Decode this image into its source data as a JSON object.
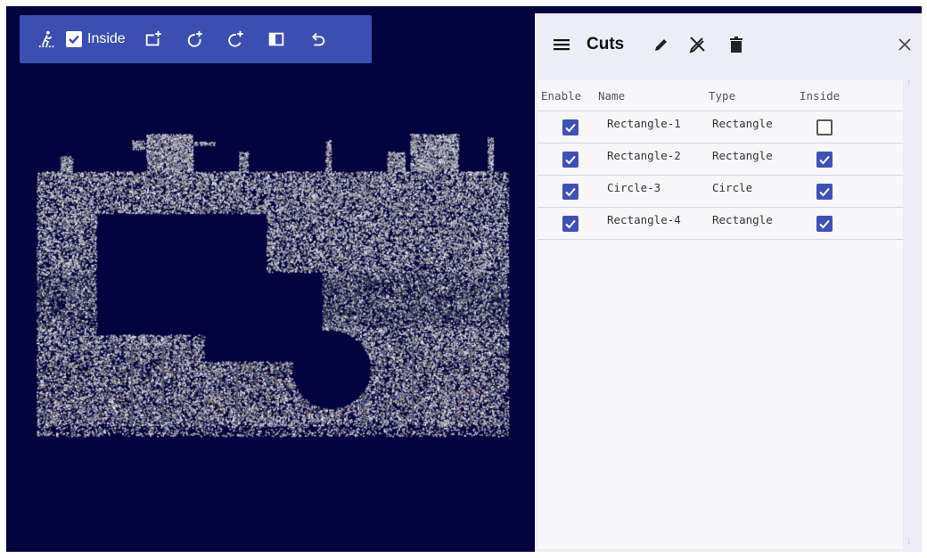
{
  "colors": {
    "viewport_bg": "#02033f",
    "toolbar_bg": "#3b4fb1",
    "accent": "#3f51b5",
    "panel_bg": "#ecedf7"
  },
  "toolbar": {
    "items": [
      {
        "icon": "person-walk-icon"
      },
      {
        "icon": "checkbox-checked-icon",
        "label": "Inside",
        "checked": true
      },
      {
        "icon": "add-rectangle-icon"
      },
      {
        "icon": "add-circle-icon"
      },
      {
        "icon": "add-circle-alt-icon"
      },
      {
        "icon": "rectangle-toggle-icon"
      },
      {
        "icon": "undo-icon"
      }
    ]
  },
  "panel": {
    "title": "Cuts",
    "icons": [
      "menu-icon",
      "pencil-icon",
      "edit-off-icon",
      "trash-icon",
      "close-icon"
    ],
    "columns": [
      "Enable",
      "Name",
      "Type",
      "Inside"
    ],
    "rows": [
      {
        "enable": true,
        "name": "Rectangle-1",
        "type": "Rectangle",
        "inside": false
      },
      {
        "enable": true,
        "name": "Rectangle-2",
        "type": "Rectangle",
        "inside": true
      },
      {
        "enable": true,
        "name": "Circle-3",
        "type": "Circle",
        "inside": true
      },
      {
        "enable": true,
        "name": "Rectangle-4",
        "type": "Rectangle",
        "inside": true
      }
    ]
  }
}
